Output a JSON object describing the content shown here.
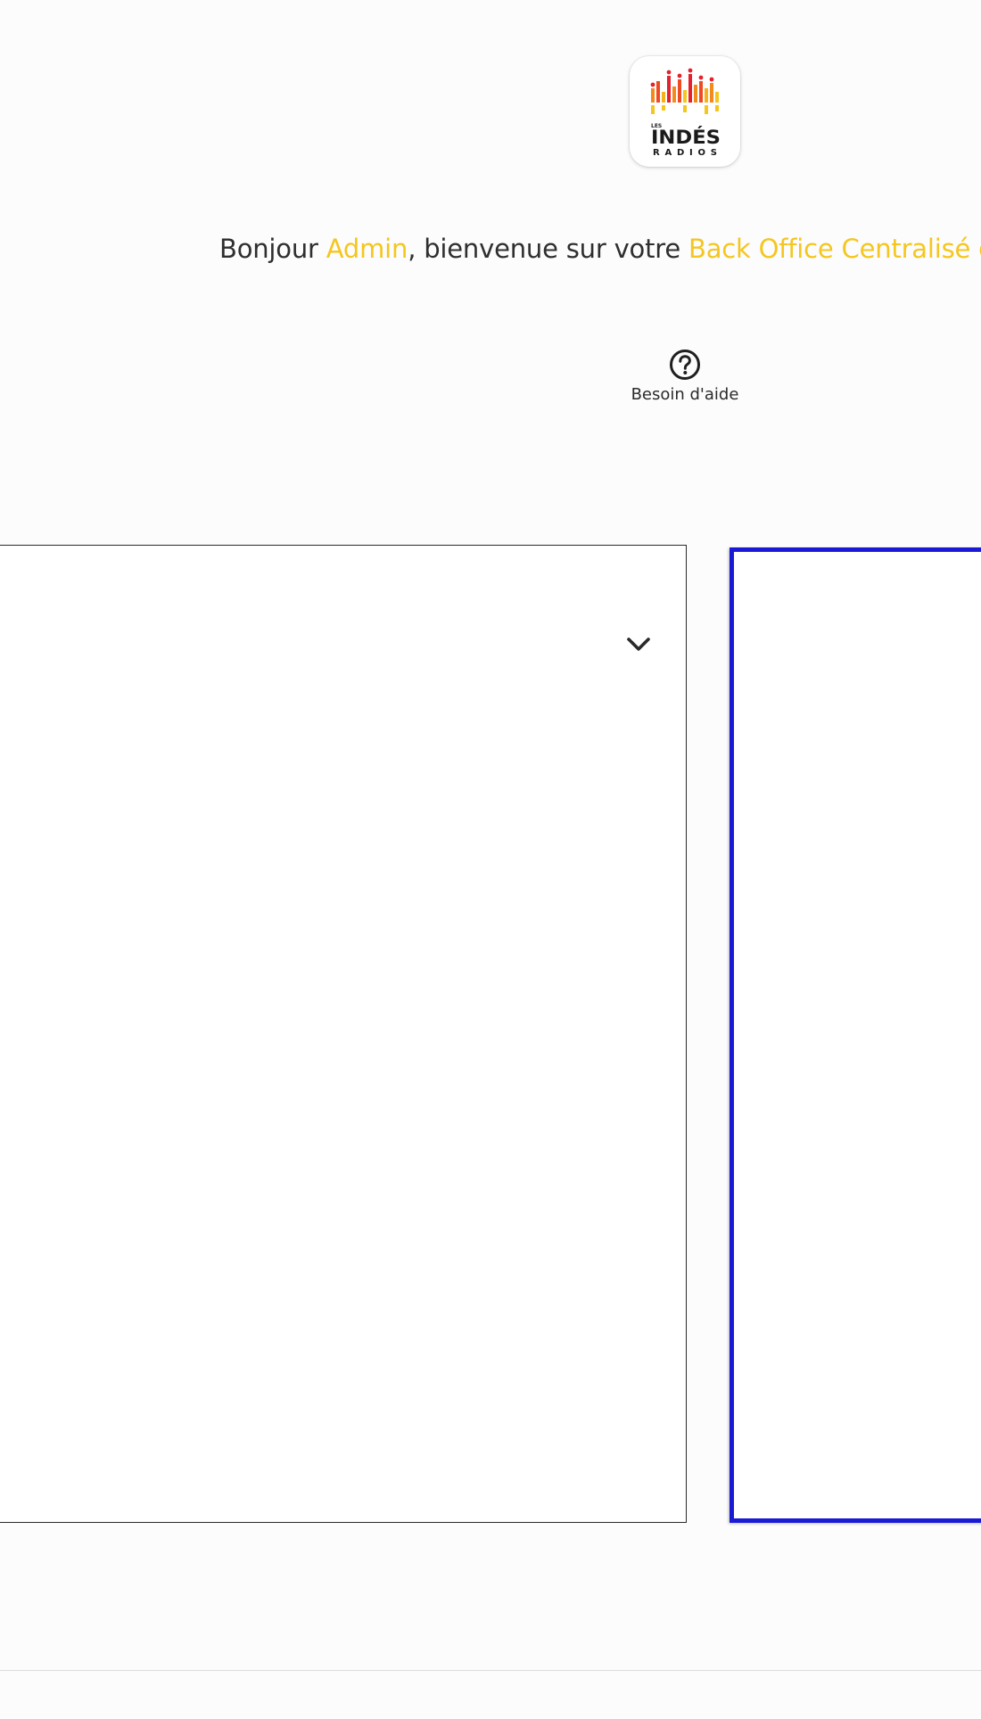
{
  "header": {
    "logo_icon": "les-indes-radios-logo",
    "logo_text": {
      "small": "LES",
      "main": "INDÉS",
      "sub": "RADIOS"
    }
  },
  "welcome": {
    "prefix": "Bonjour ",
    "user_name": "Admin",
    "middle": ", bienvenue sur votre ",
    "product": "Back Office Centralisé des"
  },
  "help": {
    "icon": "question-circle-icon",
    "label": "Besoin d'aide"
  },
  "panel_left": {
    "dropdown_icon": "chevron-down-icon"
  },
  "colors": {
    "accent": "#f5c61f",
    "selection_border": "#1a1ad6",
    "text": "#2f2f2f"
  }
}
